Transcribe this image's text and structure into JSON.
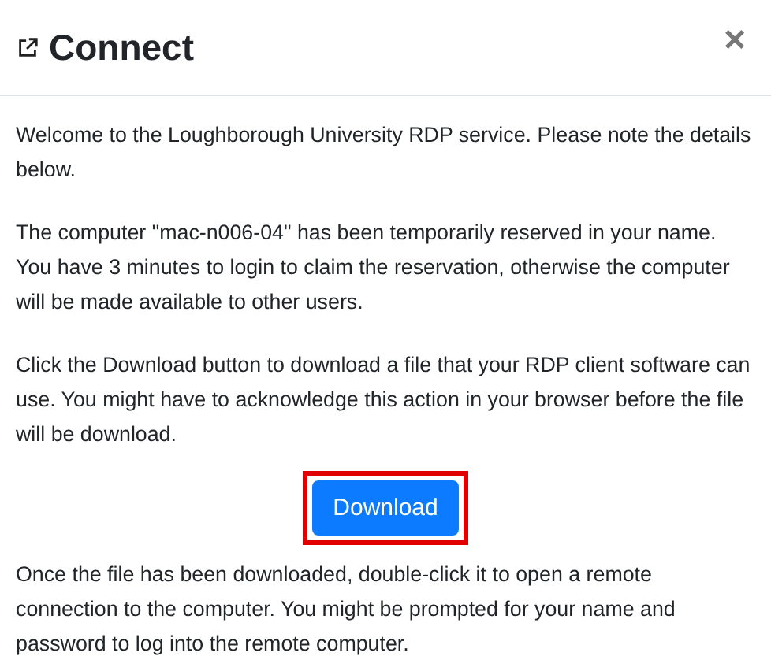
{
  "dialog": {
    "title": "Connect",
    "close": "×"
  },
  "paragraphs": [
    "Welcome to the Loughborough University RDP service. Please note the details below.",
    "The computer \"mac-n006-04\" has been temporarily reserved in your name. You have 3 minutes to login to claim the reservation, otherwise the computer will be made available to other users.",
    "Click the Download button to download a file that your RDP client software can use. You might have to acknowledge this action in your browser before the file will be download."
  ],
  "button": {
    "label": "Download",
    "highlighted": true
  },
  "footer_text": "Once the file has been downloaded, double-click it to open a remote connection to the computer. You might be prompted for your name and password to log into the remote computer."
}
